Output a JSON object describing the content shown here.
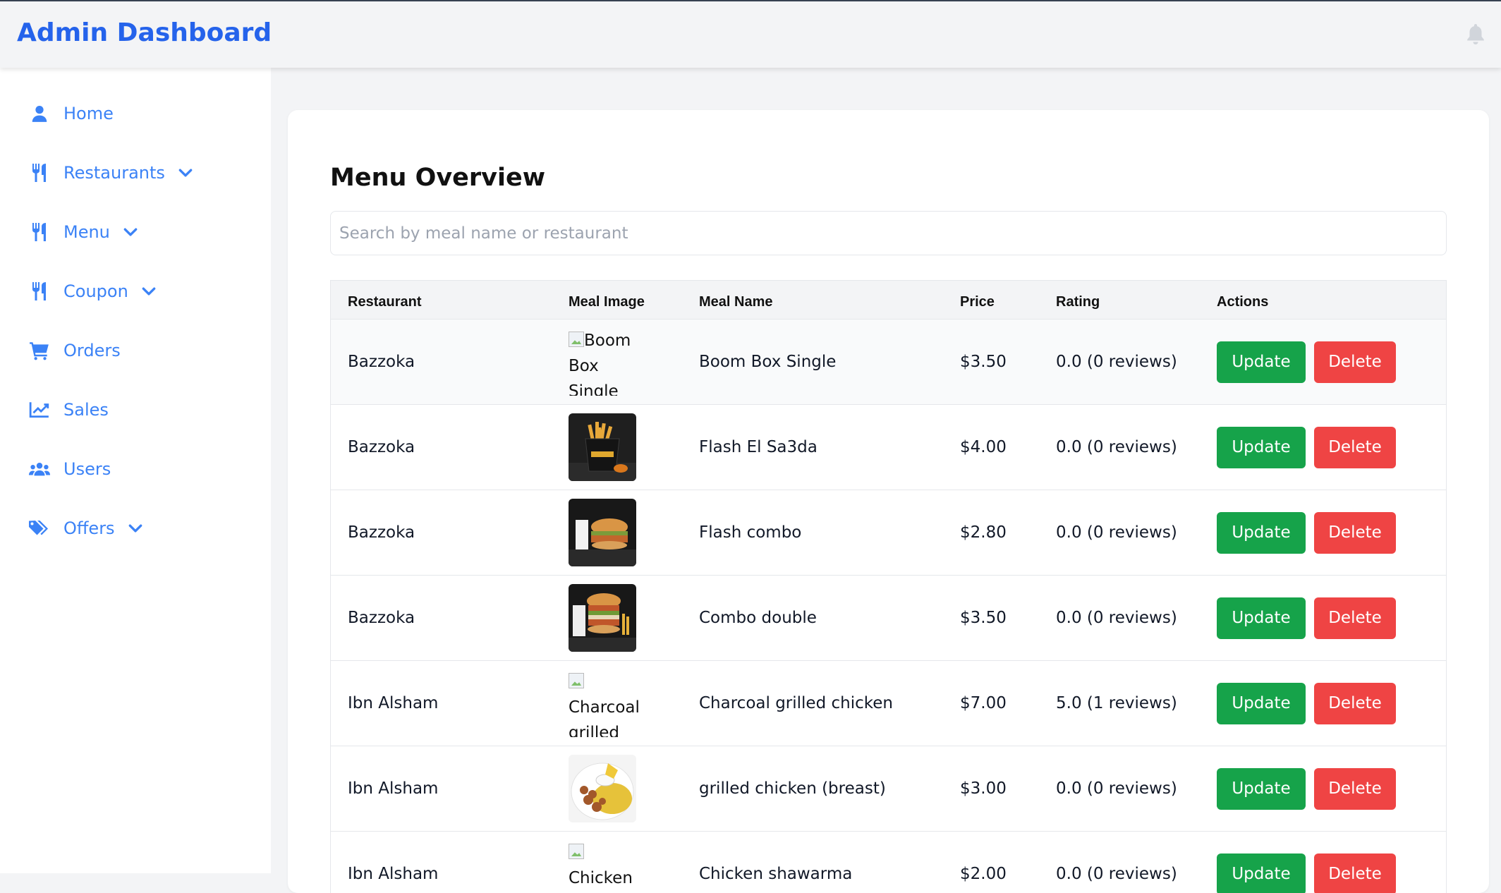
{
  "header": {
    "title": "Admin Dashboard",
    "bell_icon": "bell-icon"
  },
  "sidebar": {
    "items": [
      {
        "label": "Home",
        "icon": "user-icon",
        "expandable": false
      },
      {
        "label": "Restaurants",
        "icon": "utensils-icon",
        "expandable": true
      },
      {
        "label": "Menu",
        "icon": "utensils-icon",
        "expandable": true
      },
      {
        "label": "Coupon",
        "icon": "utensils-icon",
        "expandable": true
      },
      {
        "label": "Orders",
        "icon": "cart-icon",
        "expandable": false
      },
      {
        "label": "Sales",
        "icon": "chart-line-icon",
        "expandable": false
      },
      {
        "label": "Users",
        "icon": "users-icon",
        "expandable": false
      },
      {
        "label": "Offers",
        "icon": "tags-icon",
        "expandable": true
      }
    ]
  },
  "main": {
    "title": "Menu Overview",
    "search": {
      "placeholder": "Search by meal name or restaurant",
      "value": ""
    },
    "table": {
      "columns": [
        "Restaurant",
        "Meal Image",
        "Meal Name",
        "Price",
        "Rating",
        "Actions"
      ],
      "rows": [
        {
          "restaurant": "Bazzoka",
          "image_alt": "Boom Box Single",
          "image": "broken",
          "meal_name": "Boom Box Single",
          "price": "$3.50",
          "rating": "0.0 (0 reviews)"
        },
        {
          "restaurant": "Bazzoka",
          "image_alt": "Flash El Sa3da",
          "image": "fries-bucket",
          "meal_name": "Flash El Sa3da",
          "price": "$4.00",
          "rating": "0.0 (0 reviews)"
        },
        {
          "restaurant": "Bazzoka",
          "image_alt": "Flash combo",
          "image": "burger-combo",
          "meal_name": "Flash combo",
          "price": "$2.80",
          "rating": "0.0 (0 reviews)"
        },
        {
          "restaurant": "Bazzoka",
          "image_alt": "Combo double",
          "image": "double-burger",
          "meal_name": "Combo double",
          "price": "$3.50",
          "rating": "0.0 (0 reviews)"
        },
        {
          "restaurant": "Ibn Alsham",
          "image_alt": "Charcoal grilled",
          "image": "broken",
          "meal_name": "Charcoal grilled chicken",
          "price": "$7.00",
          "rating": "5.0 (1 reviews)"
        },
        {
          "restaurant": "Ibn Alsham",
          "image_alt": "grilled chicken (breast)",
          "image": "chicken-plate",
          "meal_name": "grilled chicken (breast)",
          "price": "$3.00",
          "rating": "0.0 (0 reviews)"
        },
        {
          "restaurant": "Ibn Alsham",
          "image_alt": "Chicken",
          "image": "broken",
          "meal_name": "Chicken shawarma",
          "price": "$2.00",
          "rating": "0.0 (0 reviews)"
        }
      ],
      "actions": {
        "update_label": "Update",
        "delete_label": "Delete"
      }
    }
  },
  "colors": {
    "brand": "#2563eb",
    "nav": "#3b82f6",
    "update": "#16a34a",
    "delete": "#ef4444"
  }
}
